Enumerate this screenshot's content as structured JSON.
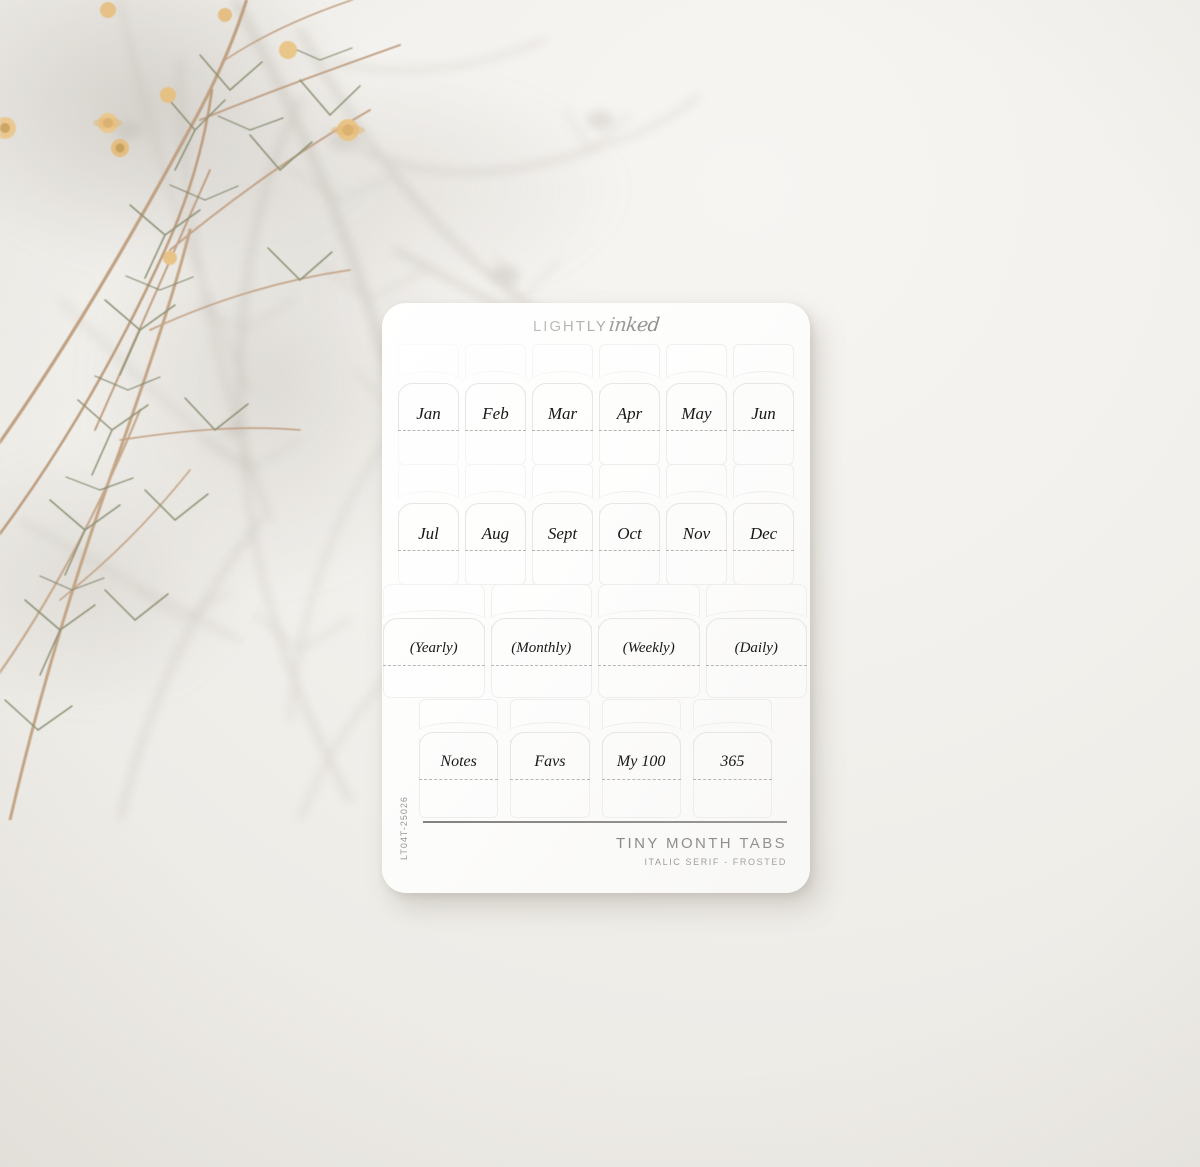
{
  "scene": {
    "background_color": "#f1efeb",
    "shadow_color": "#d8d4cf",
    "subject": "dried-flower-stems-with-cast-shadow"
  },
  "card": {
    "surface_color": "#fdfdfc",
    "cut_line_color": "#e7e6e4",
    "fold_line_color": "#b9b6b2",
    "ink_color": "#181818",
    "brand": {
      "word_one": "LIGHTLY",
      "word_two": "inked"
    },
    "sku": "LT04T-25026",
    "footer": {
      "title": "TINY MONTH TABS",
      "subtitle": "ITALIC SERIF - FROSTED"
    }
  },
  "rows": [
    {
      "name": "months-first-half",
      "tabs": [
        {
          "label": "Jan"
        },
        {
          "label": "Feb"
        },
        {
          "label": "Mar"
        },
        {
          "label": "Apr"
        },
        {
          "label": "May"
        },
        {
          "label": "Jun"
        }
      ]
    },
    {
      "name": "months-second-half",
      "tabs": [
        {
          "label": "Jul"
        },
        {
          "label": "Aug"
        },
        {
          "label": "Sept"
        },
        {
          "label": "Oct"
        },
        {
          "label": "Nov"
        },
        {
          "label": "Dec"
        }
      ]
    },
    {
      "name": "planning-intervals",
      "tabs": [
        {
          "label": "(Yearly)"
        },
        {
          "label": "(Monthly)"
        },
        {
          "label": "(Weekly)"
        },
        {
          "label": "(Daily)"
        }
      ]
    },
    {
      "name": "collections",
      "tabs": [
        {
          "label": "Notes"
        },
        {
          "label": "Favs"
        },
        {
          "label": "My 100"
        },
        {
          "label": "365"
        }
      ]
    }
  ]
}
